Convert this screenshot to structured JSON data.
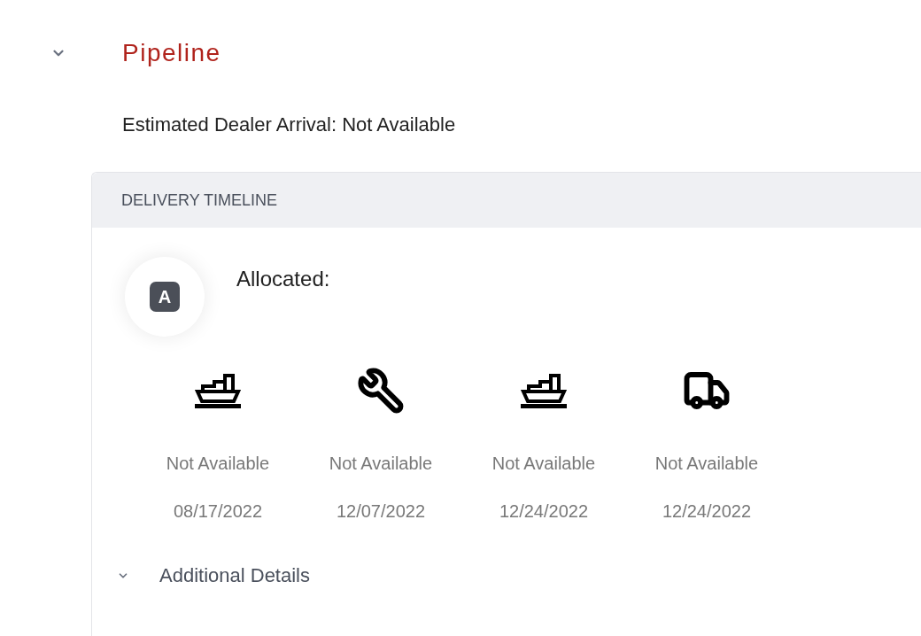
{
  "section": {
    "title": "Pipeline",
    "expanded": true
  },
  "estimated_arrival": "Estimated Dealer Arrival: Not Available",
  "timeline": {
    "header": "DELIVERY TIMELINE",
    "status": {
      "badge": "A",
      "label": "Allocated:"
    },
    "milestones": [
      {
        "kind": "ship",
        "status": "Not Available",
        "date": "08/17/2022"
      },
      {
        "kind": "wrench",
        "status": "Not Available",
        "date": "12/07/2022"
      },
      {
        "kind": "ship",
        "status": "Not Available",
        "date": "12/24/2022"
      },
      {
        "kind": "truck",
        "status": "Not Available",
        "date": "12/24/2022"
      }
    ],
    "additional_details": {
      "label": "Additional Details",
      "expanded": true
    }
  }
}
